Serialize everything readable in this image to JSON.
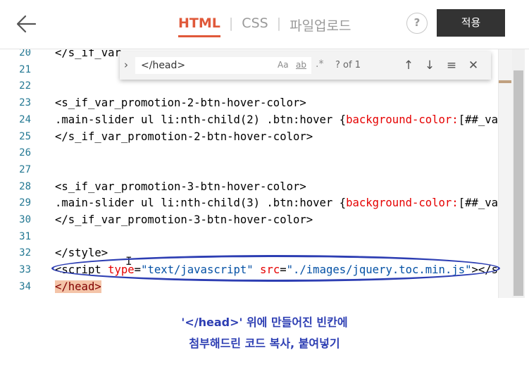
{
  "header": {
    "tabs": [
      {
        "label": "HTML",
        "active": true
      },
      {
        "label": "CSS",
        "active": false
      },
      {
        "label": "파일업로드",
        "active": false
      }
    ],
    "help_label": "?",
    "apply_label": "적용"
  },
  "icons": {
    "back": "arrow-left-icon",
    "help": "question-icon"
  },
  "find": {
    "query": "</head>",
    "match_case": "Aa",
    "whole_word": "ab",
    "regex": ".*",
    "count": "? of 1",
    "prev": "↑",
    "next": "↓",
    "selection": "≡",
    "close": "✕"
  },
  "editor": {
    "lines": [
      {
        "no": "20",
        "text": "</s_if_var"
      },
      {
        "no": "21",
        "text": ""
      },
      {
        "no": "22",
        "text": ""
      },
      {
        "no": "23",
        "text": "<s_if_var_promotion-2-btn-hover-color>"
      },
      {
        "no": "24",
        "pre": ".main-slider ul li:nth-child(2) .btn:hover {",
        "attr": "background-color:",
        "post": "[##_var"
      },
      {
        "no": "25",
        "text": "</s_if_var_promotion-2-btn-hover-color>"
      },
      {
        "no": "26",
        "text": ""
      },
      {
        "no": "27",
        "text": ""
      },
      {
        "no": "28",
        "text": "<s_if_var_promotion-3-btn-hover-color>"
      },
      {
        "no": "29",
        "pre": ".main-slider ul li:nth-child(3) .btn:hover {",
        "attr": "background-color:",
        "post": "[##_var"
      },
      {
        "no": "30",
        "text": "</s_if_var_promotion-3-btn-hover-color>"
      },
      {
        "no": "31",
        "text": ""
      },
      {
        "no": "32",
        "text": "</style>"
      },
      {
        "no": "33",
        "open": "<script ",
        "attr1": "type",
        "eq1": "=",
        "str1": "\"text/javascript\"",
        "attr2": " src",
        "eq2": "=",
        "str2": "\"./images/jquery.toc.min.js\"",
        "close": "></sc"
      },
      {
        "no": "34",
        "text": "</head>"
      }
    ]
  },
  "caption": {
    "line1": "'</head>' 위에 만들어진 빈칸에",
    "line2": "첨부해드린 코드 복사, 붙여넣기"
  },
  "colors": {
    "accent": "#e0593a",
    "annotation": "#2d3eb3",
    "line_numbers": "#237893",
    "css_property": "#e50000",
    "string": "#0451a5",
    "head_highlight": "#f4c4a8",
    "apply_button": "#333333"
  }
}
